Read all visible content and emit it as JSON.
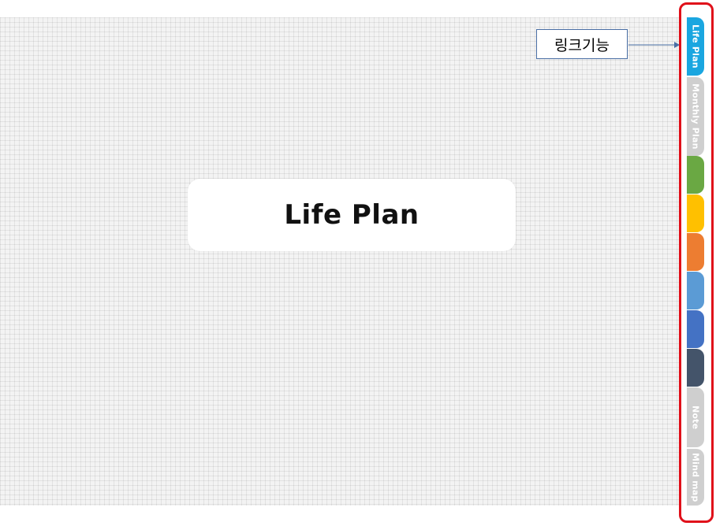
{
  "main": {
    "title": "Life Plan"
  },
  "annotation": {
    "label": "링크기능"
  },
  "tabs": [
    {
      "label": "Life Plan",
      "color": "#1aa6e0"
    },
    {
      "label": "Monthly Plan",
      "color": "#cfcfcf"
    },
    {
      "label": "",
      "color": "#6aa843"
    },
    {
      "label": "",
      "color": "#ffc000"
    },
    {
      "label": "",
      "color": "#ed7d31"
    },
    {
      "label": "",
      "color": "#5b9bd5"
    },
    {
      "label": "",
      "color": "#4472c4"
    },
    {
      "label": "",
      "color": "#44546a"
    },
    {
      "label": "Note",
      "color": "#cfcfcf"
    },
    {
      "label": "Mind map",
      "color": "#cfcfcf"
    }
  ],
  "highlight_color": "#e0101a"
}
